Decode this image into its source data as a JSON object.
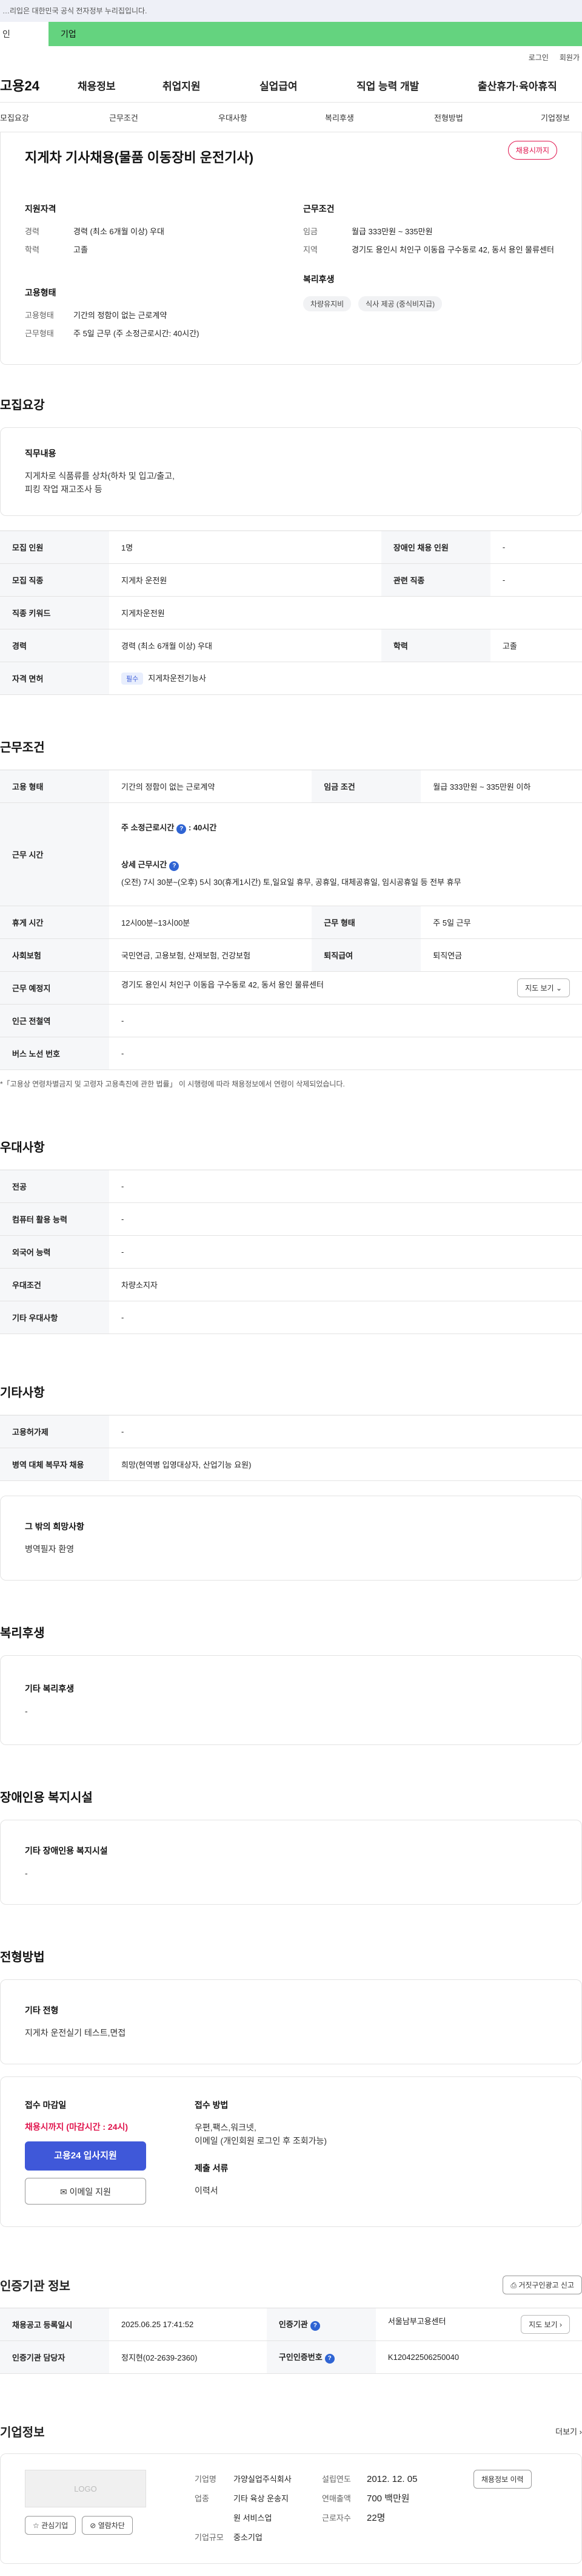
{
  "topbar": {
    "notice": "…리입은 대한민국 공식 전자정부 누리집입니다."
  },
  "tabs": [
    "인",
    "기업"
  ],
  "util": {
    "login": "로그인",
    "signup": "회원가"
  },
  "gnb": {
    "logo": "고용24",
    "menus": [
      "채용정보",
      "취업지원",
      "실업급여",
      "직업 능력 개발",
      "출산휴가·육아휴직"
    ]
  },
  "anchors": [
    "모집요강",
    "근무조건",
    "우대사항",
    "복리후생",
    "전형방법",
    "기업정보"
  ],
  "job": {
    "title": "지게차 기사채용(물품 이동장비 운전기사)",
    "badge": "채용시까지",
    "qual_head": "지원자격",
    "qual": [
      {
        "k": "경력",
        "v": "경력 (최소 6개월 이상) 우대"
      },
      {
        "k": "학력",
        "v": "고졸"
      }
    ],
    "cond_head": "근무조건",
    "cond": [
      {
        "k": "임금",
        "v": "월급 333만원 ~ 335만원"
      },
      {
        "k": "지역",
        "v": "경기도 용인시 처인구 이동읍 구수동로 42, 동서 용인 물류센터"
      }
    ],
    "emp_head": "고용형태",
    "emp": [
      {
        "k": "고용형태",
        "v": "기간의 정함이 없는 근로계약"
      },
      {
        "k": "근무형태",
        "v": "주 5일 근무 (주 소정근로시간: 40시간)"
      }
    ],
    "welfare_head": "복리후생",
    "welfare_chips": [
      "차량유지비",
      "식사 제공 (중식비지급)"
    ]
  },
  "recruit": {
    "title": "모집요강",
    "duty_head": "직무내용",
    "duty_lines": [
      "지게차로 식품류를 상차(하차 및 입고/출고,",
      "피킹 작업 재고조사 등"
    ],
    "rows": [
      {
        "k1": "모집 인원",
        "v1": "1명",
        "k2": "장애인 채용 인원",
        "v2": "-"
      },
      {
        "k1": "모집 직종",
        "v1": "지게차 운전원",
        "k2": "관련 직종",
        "v2": "-"
      },
      {
        "k1": "직종 키워드",
        "v1": "지게차운전원"
      },
      {
        "k1": "경력",
        "v1": "경력 (최소 6개월 이상) 우대",
        "k2": "학력",
        "v2": "고졸"
      },
      {
        "k1": "자격 면허",
        "tag": "필수",
        "v1": "지게차운전기능사"
      }
    ]
  },
  "work": {
    "title": "근무조건",
    "emp_k": "고용 형태",
    "emp_v": "기간의 정함이 없는 근로계약",
    "wage_k": "임금 조건",
    "wage_v": "월급 333만원 ~ 335만원 이하",
    "time_k": "근무 시간",
    "time_weekly": "주 소정근로시간",
    "time_weekly_v": "40시간",
    "time_detail_head": "상세 근무시간",
    "time_detail": "(오전) 7시 30분~(오후) 5시 30(휴게1시간) 토,일요일 휴무, 공휴일, 대체공휴일, 임시공휴일 등 전부 휴무",
    "break_k": "휴게 시간",
    "break_v": "12시00분~13시00분",
    "form_k": "근무 형태",
    "form_v": "주 5일 근무",
    "ins_k": "사회보험",
    "ins_v": "국민연금, 고용보험, 산재보험, 건강보험",
    "sev_k": "퇴직급여",
    "sev_v": "퇴직연금",
    "place_k": "근무 예정지",
    "place_v": "경기도 용인시 처인구 이동읍 구수동로 42, 동서 용인 물류센터",
    "map_btn": "지도 보기",
    "subway_k": "인근 전철역",
    "subway_v": "-",
    "bus_k": "버스 노선 번호",
    "bus_v": "-",
    "note": "*「고용상 연령차별금지 및 고령자 고용촉진에 관한 법률」 이 시행령에 따라 채용정보에서 연령이 삭제되었습니다."
  },
  "pref": {
    "title": "우대사항",
    "rows": [
      {
        "k": "전공",
        "v": "-"
      },
      {
        "k": "컴퓨터 활용 능력",
        "v": "-"
      },
      {
        "k": "외국어 능력",
        "v": "-"
      },
      {
        "k": "우대조건",
        "v": "차량소지자"
      },
      {
        "k": "기타 우대사항",
        "v": "-"
      }
    ]
  },
  "etc": {
    "title": "기타사항",
    "rows": [
      {
        "k": "고용허가제",
        "v": "-"
      },
      {
        "k": "병역 대체 복무자 채용",
        "v": "희망(현역병 입영대상자, 산업기능 요원)"
      }
    ],
    "box_head": "그 밖의 희망사항",
    "box_v": "병역필자 환영"
  },
  "welfare": {
    "title": "복리후생",
    "head": "기타 복리후생",
    "v": "-"
  },
  "disability": {
    "title": "장애인용 복지시설",
    "head": "기타 장애인용 복지시설",
    "v": "-"
  },
  "select": {
    "title": "전형방법",
    "head": "기타 전형",
    "v": "지게차 운전실기 테스트,면접",
    "deadline_head": "접수 마감일",
    "deadline_v": "채용시까지 (마감시간 : 24시)",
    "apply_btn": "고용24 입사지원",
    "mail_btn": "이메일 지원",
    "method_head": "접수 방법",
    "method_v1": "우편,팩스,워크넷,",
    "method_v2": "이메일 (개인회원 로그인 후 조회가능)",
    "doc_head": "제출 서류",
    "doc_v": "이력서"
  },
  "cert": {
    "title": "인증기관 정보",
    "btn": "거짓구인광고 신고",
    "reg_k": "채용공고 등록일시",
    "reg_v": "2025.06.25 17:41:52",
    "org_k": "인증기관",
    "org_v": "서울남부고용센터",
    "map_btn": "지도 보기",
    "mgr_k": "인증기관 담당자",
    "mgr_v": "정지현(02-2639-2360)",
    "num_k": "구인인증번호",
    "num_v": "K120422506250040"
  },
  "company": {
    "title": "기업정보",
    "more": "더보기",
    "logo": "LOGO",
    "fav": "관심기업",
    "block": "열람차단",
    "name_k": "기업명",
    "name_v": "가양실업주식회사",
    "biz_k": "업종",
    "biz_v1": "기타 육상 운송지",
    "biz_v2": "원 서비스업",
    "size_k": "기업규모",
    "size_v": "중소기업",
    "year_k": "설립연도",
    "year_v": "2012. 12. 05",
    "sales_k": "연매출액",
    "sales_v": "700 백만원",
    "emp_k": "근로자수",
    "emp_v": "22명",
    "hist_btn": "채용정보 이력"
  }
}
